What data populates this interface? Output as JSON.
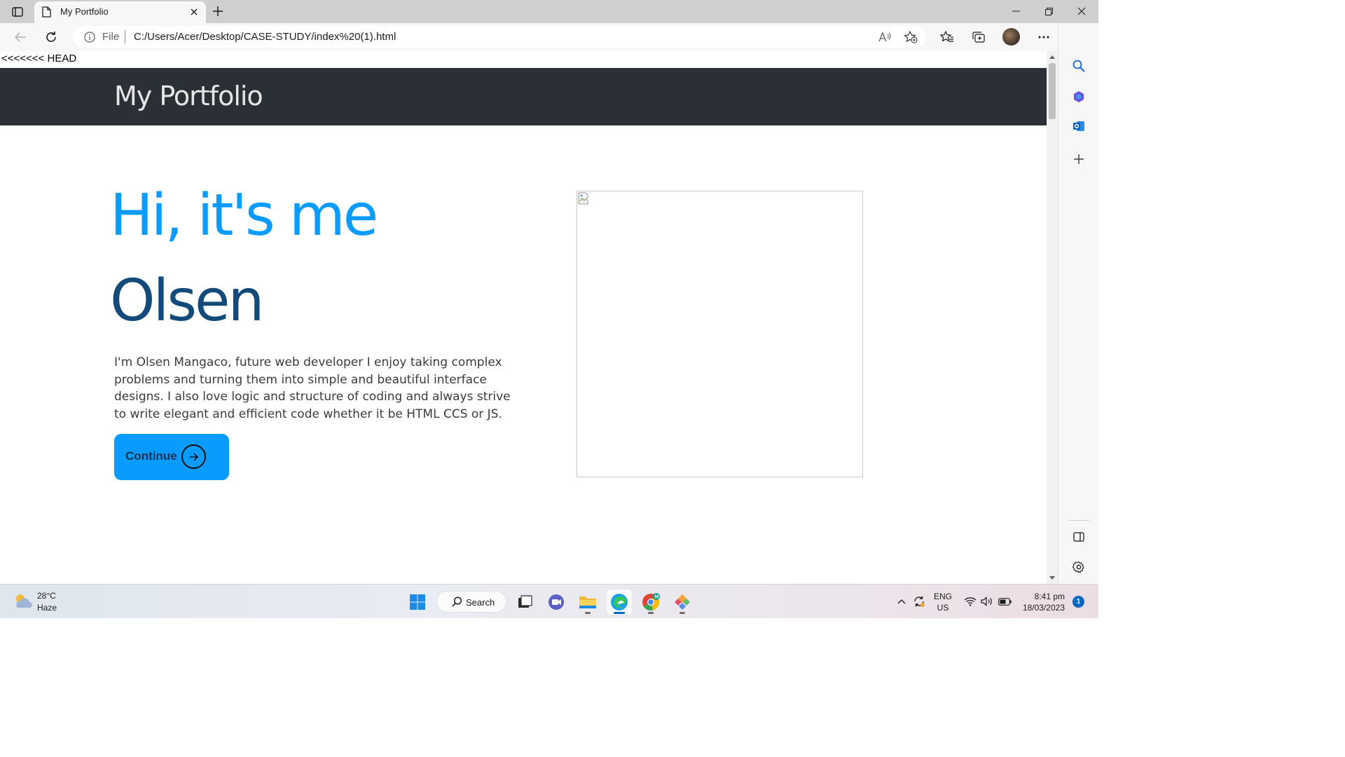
{
  "browser": {
    "tab_title": "My Portfolio",
    "address": {
      "scheme_label": "File",
      "url": "C:/Users/Acer/Desktop/CASE-STUDY/index%20(1).html"
    }
  },
  "page": {
    "merge_marker": "<<<<<<< HEAD",
    "logo": "My Portfolio",
    "greeting": "Hi, it's me",
    "name": "Olsen",
    "bio": "I'm Olsen Mangaco, future web developer I enjoy taking complex problems and turning them into simple and beautiful interface designs. I also love logic and structure of coding and always strive to write elegant and efficient code whether it be HTML CCS or JS.",
    "continue_label": "Continue",
    "colors": {
      "accent": "#0a9bff",
      "name": "#124b79",
      "header": "#2b2f36"
    }
  },
  "taskbar": {
    "weather_temp": "28°C",
    "weather_desc": "Haze",
    "search_label": "Search",
    "lang_primary": "ENG",
    "lang_secondary": "US",
    "time": "8:41 pm",
    "date": "18/03/2023",
    "notification_count": "1"
  }
}
